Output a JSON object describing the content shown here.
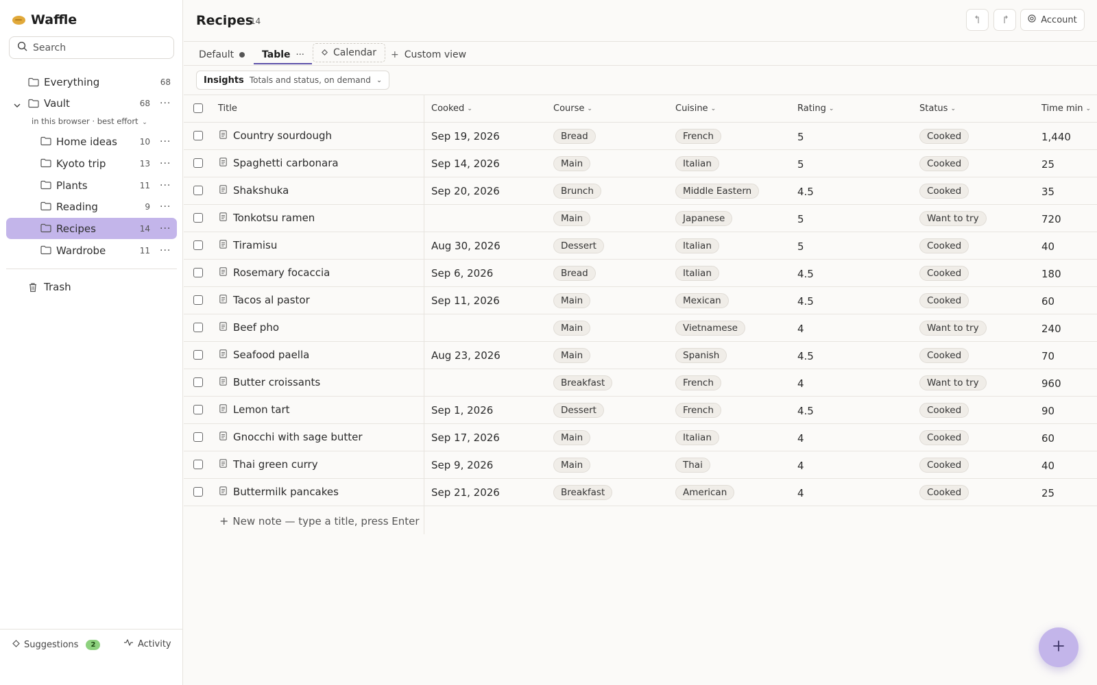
{
  "app": {
    "name": "Waffle"
  },
  "search": {
    "placeholder": "Search"
  },
  "sidebar": {
    "everything": {
      "label": "Everything",
      "count": "68"
    },
    "vault": {
      "label": "Vault",
      "count": "68",
      "sub": "in this browser · best effort"
    },
    "folders": [
      {
        "label": "Home ideas",
        "count": "10",
        "active": false
      },
      {
        "label": "Kyoto trip",
        "count": "13",
        "active": false
      },
      {
        "label": "Plants",
        "count": "11",
        "active": false
      },
      {
        "label": "Reading",
        "count": "9",
        "active": false
      },
      {
        "label": "Recipes",
        "count": "14",
        "active": true
      },
      {
        "label": "Wardrobe",
        "count": "11",
        "active": false
      }
    ],
    "trash": "Trash",
    "suggestions": {
      "label": "Suggestions",
      "count": "2"
    },
    "activity": "Activity"
  },
  "header": {
    "title": "Recipes",
    "count": "14",
    "account": "Account"
  },
  "tabs": [
    {
      "label": "Default"
    },
    {
      "label": "Table"
    },
    {
      "label": "Calendar"
    },
    {
      "label": "Custom view"
    }
  ],
  "insights": {
    "label": "Insights",
    "sub": "Totals and status, on demand"
  },
  "table": {
    "columns": [
      "Title",
      "Cooked",
      "Course",
      "Cuisine",
      "Rating",
      "Status",
      "Time min"
    ],
    "rows": [
      {
        "title": "Country sourdough",
        "cooked": "Sep 19, 2026",
        "course": "Bread",
        "cuisine": "French",
        "rating": "5",
        "status": "Cooked",
        "time": "1,440"
      },
      {
        "title": "Spaghetti carbonara",
        "cooked": "Sep 14, 2026",
        "course": "Main",
        "cuisine": "Italian",
        "rating": "5",
        "status": "Cooked",
        "time": "25"
      },
      {
        "title": "Shakshuka",
        "cooked": "Sep 20, 2026",
        "course": "Brunch",
        "cuisine": "Middle Eastern",
        "rating": "4.5",
        "status": "Cooked",
        "time": "35"
      },
      {
        "title": "Tonkotsu ramen",
        "cooked": "",
        "course": "Main",
        "cuisine": "Japanese",
        "rating": "5",
        "status": "Want to try",
        "time": "720"
      },
      {
        "title": "Tiramisu",
        "cooked": "Aug 30, 2026",
        "course": "Dessert",
        "cuisine": "Italian",
        "rating": "5",
        "status": "Cooked",
        "time": "40"
      },
      {
        "title": "Rosemary focaccia",
        "cooked": "Sep 6, 2026",
        "course": "Bread",
        "cuisine": "Italian",
        "rating": "4.5",
        "status": "Cooked",
        "time": "180"
      },
      {
        "title": "Tacos al pastor",
        "cooked": "Sep 11, 2026",
        "course": "Main",
        "cuisine": "Mexican",
        "rating": "4.5",
        "status": "Cooked",
        "time": "60"
      },
      {
        "title": "Beef pho",
        "cooked": "",
        "course": "Main",
        "cuisine": "Vietnamese",
        "rating": "4",
        "status": "Want to try",
        "time": "240"
      },
      {
        "title": "Seafood paella",
        "cooked": "Aug 23, 2026",
        "course": "Main",
        "cuisine": "Spanish",
        "rating": "4.5",
        "status": "Cooked",
        "time": "70"
      },
      {
        "title": "Butter croissants",
        "cooked": "",
        "course": "Breakfast",
        "cuisine": "French",
        "rating": "4",
        "status": "Want to try",
        "time": "960"
      },
      {
        "title": "Lemon tart",
        "cooked": "Sep 1, 2026",
        "course": "Dessert",
        "cuisine": "French",
        "rating": "4.5",
        "status": "Cooked",
        "time": "90"
      },
      {
        "title": "Gnocchi with sage butter",
        "cooked": "Sep 17, 2026",
        "course": "Main",
        "cuisine": "Italian",
        "rating": "4",
        "status": "Cooked",
        "time": "60"
      },
      {
        "title": "Thai green curry",
        "cooked": "Sep 9, 2026",
        "course": "Main",
        "cuisine": "Thai",
        "rating": "4",
        "status": "Cooked",
        "time": "40"
      },
      {
        "title": "Buttermilk pancakes",
        "cooked": "Sep 21, 2026",
        "course": "Breakfast",
        "cuisine": "American",
        "rating": "4",
        "status": "Cooked",
        "time": "25"
      }
    ],
    "new_note": "New note — type a title, press Enter"
  },
  "colors": {
    "accent": "#c3b5ea",
    "tab_underline": "#5b4fa8",
    "badge": "#8dd17e",
    "logo": "#e1a93a"
  }
}
